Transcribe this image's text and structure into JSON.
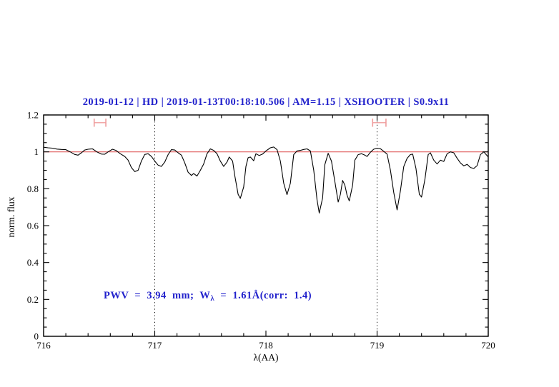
{
  "title": {
    "text": "2019-01-12 | HD | 2019-01-13T00:18:10.506 | AM=1.15 | XSHOOTER | S0.9x11"
  },
  "annotation": {
    "prefix": "PWV  =  3.94  mm;  W",
    "sub": "λ",
    "suffix": "  =  1.61Å(corr:  1.4)"
  },
  "colors": {
    "accent_blue": "#2222cc",
    "continuum_red": "#e05c5c",
    "marker_pink": "#ef9c9c",
    "spectrum_black": "#000000"
  },
  "chart_data": {
    "type": "line",
    "title": "2019-01-12 | HD | 2019-01-13T00:18:10.506 | AM=1.15 | XSHOOTER | S0.9x11",
    "xlabel": "λ(AA)",
    "ylabel": "norm. flux",
    "xlim": [
      716,
      720
    ],
    "ylim": [
      0,
      1.2
    ],
    "grid": false,
    "x_major_ticks": [
      716,
      717,
      718,
      719,
      720
    ],
    "x_tick_labels": [
      "716",
      "717",
      "718",
      "719",
      "720"
    ],
    "x_minor_step": 0.2,
    "y_major_ticks": [
      0,
      0.2,
      0.4,
      0.6,
      0.8,
      1,
      1.2
    ],
    "y_tick_labels": [
      "0",
      "0.2",
      "0.4",
      "0.6",
      "0.8",
      "1",
      "1.2"
    ],
    "y_minor_step": 0.05,
    "vlines": {
      "x": [
        717,
        719
      ],
      "style": "dotted"
    },
    "continuum": {
      "y": 1.0
    },
    "range_markers": [
      {
        "x1": 716.455,
        "x2": 716.56,
        "y": 1.158,
        "cap_half": 0.022
      },
      {
        "x1": 718.96,
        "x2": 719.08,
        "y": 1.158,
        "cap_half": 0.022
      }
    ],
    "annotation_text": "PWV = 3.94 mm; Wλ = 1.61Å(corr: 1.4)",
    "series": [
      {
        "name": "telluric-water-spectrum",
        "points": [
          [
            716.0,
            1.025
          ],
          [
            716.04,
            1.022
          ],
          [
            716.08,
            1.02
          ],
          [
            716.12,
            1.015
          ],
          [
            716.16,
            1.013
          ],
          [
            716.2,
            1.012
          ],
          [
            716.24,
            1.0
          ],
          [
            716.28,
            0.986
          ],
          [
            716.31,
            0.982
          ],
          [
            716.34,
            0.995
          ],
          [
            716.37,
            1.01
          ],
          [
            716.4,
            1.014
          ],
          [
            716.44,
            1.016
          ],
          [
            716.48,
            1.0
          ],
          [
            716.52,
            0.988
          ],
          [
            716.55,
            0.987
          ],
          [
            716.58,
            1.0
          ],
          [
            716.62,
            1.014
          ],
          [
            716.65,
            1.008
          ],
          [
            716.69,
            0.99
          ],
          [
            716.73,
            0.975
          ],
          [
            716.76,
            0.955
          ],
          [
            716.79,
            0.915
          ],
          [
            716.82,
            0.893
          ],
          [
            716.85,
            0.9
          ],
          [
            716.88,
            0.95
          ],
          [
            716.91,
            0.986
          ],
          [
            716.94,
            0.99
          ],
          [
            716.97,
            0.975
          ],
          [
            717.0,
            0.95
          ],
          [
            717.03,
            0.928
          ],
          [
            717.06,
            0.921
          ],
          [
            717.09,
            0.945
          ],
          [
            717.12,
            0.985
          ],
          [
            717.15,
            1.012
          ],
          [
            717.18,
            1.01
          ],
          [
            717.21,
            0.995
          ],
          [
            717.24,
            0.982
          ],
          [
            717.27,
            0.94
          ],
          [
            717.3,
            0.89
          ],
          [
            717.33,
            0.872
          ],
          [
            717.35,
            0.882
          ],
          [
            717.38,
            0.869
          ],
          [
            717.41,
            0.9
          ],
          [
            717.44,
            0.934
          ],
          [
            717.47,
            0.99
          ],
          [
            717.5,
            1.016
          ],
          [
            717.53,
            1.008
          ],
          [
            717.56,
            0.99
          ],
          [
            717.59,
            0.95
          ],
          [
            717.62,
            0.921
          ],
          [
            717.65,
            0.945
          ],
          [
            717.67,
            0.972
          ],
          [
            717.7,
            0.95
          ],
          [
            717.72,
            0.87
          ],
          [
            717.75,
            0.77
          ],
          [
            717.77,
            0.748
          ],
          [
            717.8,
            0.81
          ],
          [
            717.82,
            0.92
          ],
          [
            717.84,
            0.968
          ],
          [
            717.86,
            0.972
          ],
          [
            717.89,
            0.952
          ],
          [
            717.91,
            0.99
          ],
          [
            717.94,
            0.98
          ],
          [
            717.97,
            0.988
          ],
          [
            718.0,
            1.005
          ],
          [
            718.04,
            1.022
          ],
          [
            718.07,
            1.026
          ],
          [
            718.1,
            1.012
          ],
          [
            718.13,
            0.95
          ],
          [
            718.16,
            0.83
          ],
          [
            718.19,
            0.768
          ],
          [
            718.22,
            0.83
          ],
          [
            718.25,
            0.985
          ],
          [
            718.28,
            1.005
          ],
          [
            718.31,
            1.008
          ],
          [
            718.34,
            1.013
          ],
          [
            718.37,
            1.016
          ],
          [
            718.4,
            1.005
          ],
          [
            718.43,
            0.9
          ],
          [
            718.46,
            0.74
          ],
          [
            718.48,
            0.668
          ],
          [
            718.51,
            0.75
          ],
          [
            718.53,
            0.93
          ],
          [
            718.56,
            0.992
          ],
          [
            718.59,
            0.95
          ],
          [
            718.62,
            0.84
          ],
          [
            718.65,
            0.728
          ],
          [
            718.67,
            0.77
          ],
          [
            718.69,
            0.845
          ],
          [
            718.71,
            0.82
          ],
          [
            718.73,
            0.765
          ],
          [
            718.75,
            0.734
          ],
          [
            718.78,
            0.82
          ],
          [
            718.8,
            0.955
          ],
          [
            718.83,
            0.985
          ],
          [
            718.86,
            0.99
          ],
          [
            718.89,
            0.982
          ],
          [
            718.91,
            0.975
          ],
          [
            718.94,
            0.998
          ],
          [
            718.97,
            1.014
          ],
          [
            719.0,
            1.02
          ],
          [
            719.03,
            1.017
          ],
          [
            719.06,
            1.003
          ],
          [
            719.09,
            0.988
          ],
          [
            719.12,
            0.9
          ],
          [
            719.15,
            0.78
          ],
          [
            719.18,
            0.685
          ],
          [
            719.21,
            0.79
          ],
          [
            719.24,
            0.92
          ],
          [
            719.27,
            0.965
          ],
          [
            719.3,
            0.985
          ],
          [
            719.32,
            0.988
          ],
          [
            719.35,
            0.91
          ],
          [
            719.38,
            0.77
          ],
          [
            719.4,
            0.755
          ],
          [
            719.43,
            0.85
          ],
          [
            719.46,
            0.985
          ],
          [
            719.48,
            0.995
          ],
          [
            719.51,
            0.955
          ],
          [
            719.54,
            0.934
          ],
          [
            719.57,
            0.955
          ],
          [
            719.6,
            0.948
          ],
          [
            719.63,
            0.99
          ],
          [
            719.66,
            1.0
          ],
          [
            719.69,
            0.995
          ],
          [
            719.72,
            0.965
          ],
          [
            719.75,
            0.94
          ],
          [
            719.78,
            0.924
          ],
          [
            719.81,
            0.932
          ],
          [
            719.84,
            0.915
          ],
          [
            719.87,
            0.91
          ],
          [
            719.9,
            0.925
          ],
          [
            719.93,
            0.985
          ],
          [
            719.96,
            1.0
          ],
          [
            720.0,
            0.972
          ]
        ]
      }
    ]
  }
}
